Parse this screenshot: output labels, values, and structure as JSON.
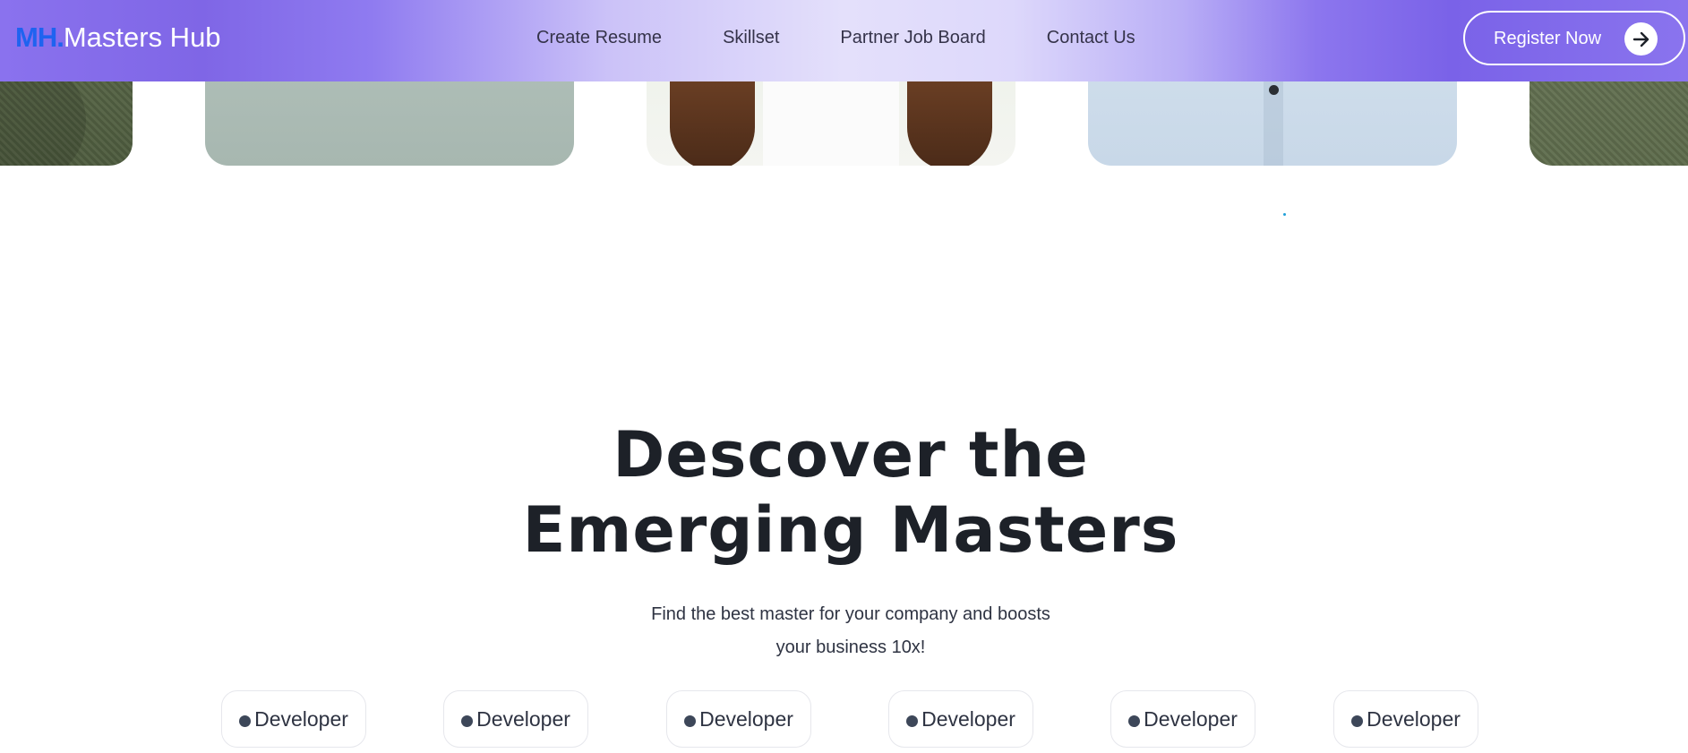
{
  "header": {
    "logo_mark": "MH.",
    "logo_text": "Masters Hub",
    "nav": [
      {
        "label": "Create Resume"
      },
      {
        "label": "Skillset"
      },
      {
        "label": "Partner Job Board"
      },
      {
        "label": "Contact Us"
      }
    ],
    "register_label": "Register Now",
    "register_icon": "arrow-right-icon"
  },
  "carousel": {
    "cards": [
      "green-sweater-photo",
      "sage-shirt-photo",
      "woman-white-shirt-photo",
      "man-blue-shirt-photo",
      "green-sweater-photo"
    ]
  },
  "hero": {
    "title_line1": "Descover the",
    "title_line2": "Emerging Masters",
    "subtitle_line1": "Find the best master for your company and boosts",
    "subtitle_line2": "your business 10x!"
  },
  "categories": [
    {
      "label": "Developer"
    },
    {
      "label": "Developer"
    },
    {
      "label": "Developer"
    },
    {
      "label": "Developer"
    },
    {
      "label": "Developer"
    },
    {
      "label": "Developer"
    }
  ],
  "colors": {
    "brand_blue": "#1f63f0",
    "header_purple": "#7f66e6",
    "text_dark": "#1d2128"
  }
}
